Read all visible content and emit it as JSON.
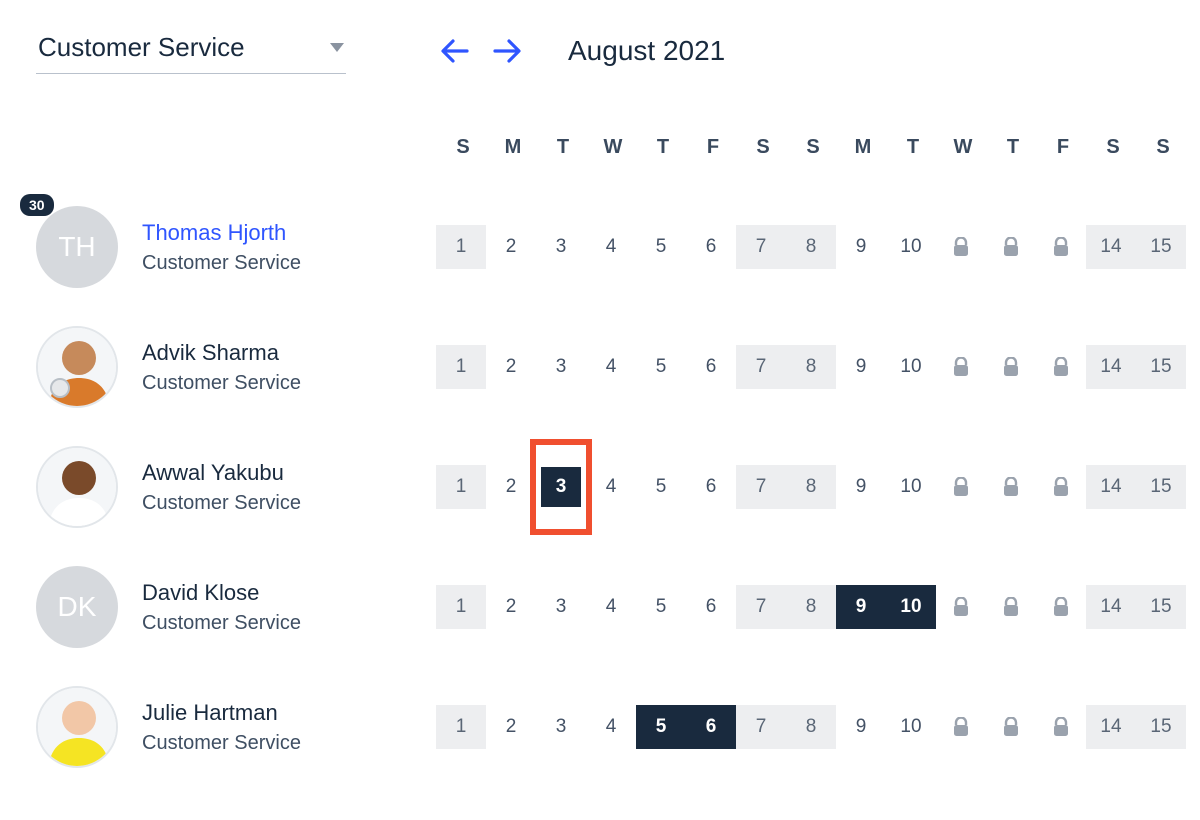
{
  "header": {
    "department_label": "Customer Service",
    "month_label": "August 2021"
  },
  "day_labels": [
    "S",
    "M",
    "T",
    "W",
    "T",
    "F",
    "S",
    "S",
    "M",
    "T",
    "W",
    "T",
    "F",
    "S",
    "S"
  ],
  "day_numbers": [
    "1",
    "2",
    "3",
    "4",
    "5",
    "6",
    "7",
    "8",
    "9",
    "10",
    "",
    "",
    "",
    "14",
    "15"
  ],
  "shaded_cols": [
    0,
    6,
    7,
    13,
    14
  ],
  "lock_cols": [
    10,
    11,
    12
  ],
  "rows": [
    {
      "name": "Thomas Hjorth",
      "dept": "Customer Service",
      "name_link": true,
      "avatar": {
        "type": "initials",
        "text": "TH"
      },
      "badge": "30",
      "selected": [],
      "highlight": null
    },
    {
      "name": "Advik Sharma",
      "dept": "Customer Service",
      "name_link": false,
      "avatar": {
        "type": "photo-1"
      },
      "badge": null,
      "selected": [],
      "highlight": null
    },
    {
      "name": "Awwal Yakubu",
      "dept": "Customer Service",
      "name_link": false,
      "avatar": {
        "type": "photo-2"
      },
      "badge": null,
      "selected": [],
      "highlight": 2
    },
    {
      "name": "David Klose",
      "dept": "Customer Service",
      "name_link": false,
      "avatar": {
        "type": "initials",
        "text": "DK"
      },
      "badge": null,
      "selected": [
        8,
        9
      ],
      "highlight": null
    },
    {
      "name": "Julie Hartman",
      "dept": "Customer Service",
      "name_link": false,
      "avatar": {
        "type": "photo-3"
      },
      "badge": null,
      "selected": [
        4,
        5
      ],
      "highlight": null
    }
  ]
}
